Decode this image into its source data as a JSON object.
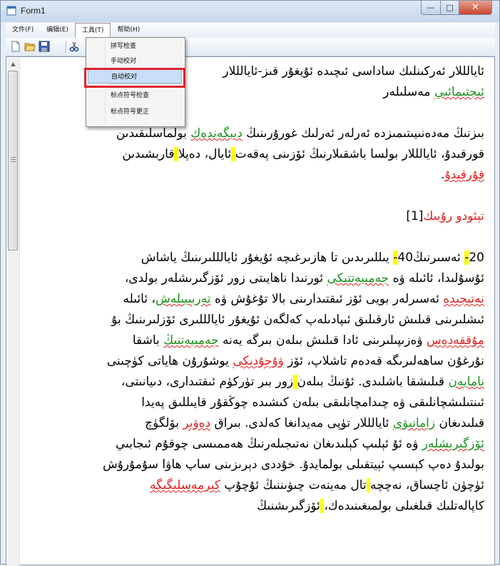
{
  "window": {
    "title": "Form1",
    "minimize": "—",
    "maximize": "□",
    "close": "✕"
  },
  "menubar": {
    "items": [
      {
        "label": "文件(F)"
      },
      {
        "label": "编辑(E)"
      },
      {
        "label": "工具(T)"
      },
      {
        "label": "帮助(H)"
      }
    ]
  },
  "toolbar": {
    "icons": [
      "new-file-icon",
      "open-folder-icon",
      "save-icon",
      "cut-icon"
    ]
  },
  "tools_menu": {
    "items": [
      {
        "label": "拼写检查"
      },
      {
        "label": "手动校对"
      },
      {
        "label": "自动校对"
      },
      {
        "label": "标点符号检查"
      },
      {
        "label": "标点符号更正"
      }
    ],
    "selected": "自动校对"
  },
  "document": {
    "p1": {
      "l1": "ئايالللار ئەركىنلىك ساداسى ئىچىدە ئۇيغۇر قىز-ئايالللار",
      "l2_word": "ئىجتىمائىي",
      "l2_rest": " مەسلىلەر"
    },
    "p2": {
      "l1_a": "بىزنىڭ مەدەنىيىتىمىزدە ئەرلەر ئەرلىك غورۇرىنىڭ ",
      "l1_word": "دىبگەندەك",
      "l1_b": " بولماسلىقىدىن",
      "l2_a": "قورقىدۇ، ئايالللار بولسا باشقىلارنىڭ ئۆزىنى پەقەت",
      "l2_hl": " ",
      "l2_b": "ئايال، دەپلا",
      "l2_hl2": " ",
      "l2_c": "قاربشىدىن",
      "l3_word": "قۇرقىدۇ",
      "l3_rest": "."
    },
    "heading": {
      "word": "تېئودو رۇبىك",
      "ref": "[1]"
    },
    "p3": [
      {
        "a": "20",
        "hl": "-",
        "b": " ئەسىرنىڭ40",
        "hl2": "-",
        "c": " يىللىرىدىن تا ھازىرغىچە ",
        "hl3": " ",
        "d": "ئۇيغۇر ئايالللىرىنىڭ ياشاش"
      },
      {
        "a": "ئۇسۇلىدا، ئائىلە ۋە ",
        "word": "جەمىيەتتىكى",
        "b": " ئورنىدا ناھايىتى زور ئۆزگىرىشلەر بولدى،"
      },
      {
        "word": "نەتىجىدە",
        "a": " ئەسىرلەر بويى ئۆز ئىقتىدارىنى بالا تۇغۇش ۋە ",
        "word2": "تەربىيىلەش",
        "b": "، ئائىلە"
      },
      {
        "a": "ئىشلىرىنى قىلىش ئارقىلىق ئىپادىلەپ كەلگەن ئۇيغۇر ئايالللىرى ئۆزلىرىنىڭ بۇ"
      },
      {
        "word": "مۇققەدەس",
        "a": " ۋەزىپىلىرىنى ئادا قىلىش بىلەن بىرگە يەنە ",
        "word2": "جەمىيەتنىڭ",
        "b": " باشقا"
      },
      {
        "a": "نۇرغۇن ساھەلىرىگە قەدەم تاشلاپ، ئۆز ",
        "word": "ۋۇجۇدىكى",
        "b": " يوشۇرۇن ھاياتى كۈچىنى"
      },
      {
        "word": "نامايەن",
        "a": " قىلىشقا باشلىدى. ئۇنىڭ بىلەن",
        "hl": " ",
        "b": "زور بىر تۈركۈم ئىقتىدارى، دىيانىتى،"
      },
      {
        "a": "ئىنتىلىشچانلىقى ۋە چىدامچانلىقى بىلەن كىشىدە چوڭقۇر قايىللىق پەيدا"
      },
      {
        "a": "قىلىدىغان ",
        "word": "زامانىۋى",
        "b": " ئايالللار تۈپى مەيدانغا كەلدى. بىراق ",
        "word2": "دەۋىر",
        "c": " بۆلگۈچ"
      },
      {
        "word": "ئۆزگىرىشلەر",
        "a": " ۋە ئۇ ئېلىپ كېلىدىغان نەتىجىلەرنىڭ ھەممىسى چوقۇم ئىجابىي"
      },
      {
        "a": "بولىدۇ دەپ كېسىپ ئېيتقىلى بولمايدۇ. خۇددى دېرىزىنى ساپ ھاۋا سۇمۇرۇش"
      },
      {
        "a": "ئۈچۈن ئاچساق، نەچچە",
        "hl": " ",
        "b": "تال مەينەت چىۋىننىڭ ئۇچۇپ ",
        "word": "كىرمەسلىگىگە"
      },
      {
        "a": "كاپالەتلىك قىلغىلى بولمىغىنىدەك،",
        "hl": " ",
        "b": "ئۆزگىرىشنىڭ"
      }
    ]
  },
  "colors": {
    "spell_green": "#1a8f1a",
    "spell_red": "#e02020",
    "highlight": "#ffff00",
    "menu_hover": "#c9dff7",
    "annotation": "#e0202d"
  }
}
